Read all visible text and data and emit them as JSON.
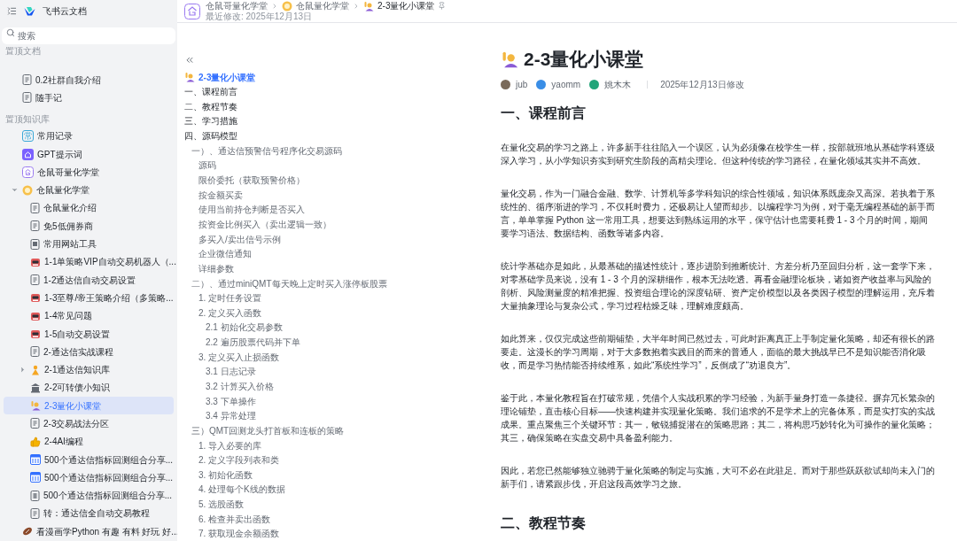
{
  "sidebar": {
    "app_title": "飞书云文档",
    "search": {
      "placeholder": "搜索"
    },
    "sections": [
      {
        "heading": "置顶文档",
        "items": [
          {
            "label": "0.2社群自我介绍",
            "kind": "doc",
            "selected": false
          },
          {
            "label": "随手记",
            "kind": "doc",
            "selected": false
          }
        ]
      },
      {
        "heading": "置顶知识库",
        "items": [
          {
            "label": "常用记录",
            "kind": "letter",
            "badge": "常",
            "selected": false
          },
          {
            "label": "GPT提示词",
            "kind": "home",
            "selected": false
          },
          {
            "label": "仓鼠哥量化学堂",
            "kind": "logo",
            "selected": false
          },
          {
            "label": "仓鼠量化学堂",
            "kind": "medal",
            "selected": false,
            "expanded": true,
            "children": [
              {
                "label": "仓鼠量化介绍",
                "kind": "doc",
                "selected": false
              },
              {
                "label": "免5低佣券商",
                "kind": "doc",
                "selected": false
              },
              {
                "label": "常用网站工具",
                "kind": "grid",
                "selected": false
              },
              {
                "label": "1-1单策略VIP自动交易机器人（...",
                "kind": "robot",
                "selected": false
              },
              {
                "label": "1-2通达信自动交易设置",
                "kind": "doc",
                "selected": false
              },
              {
                "label": "1-3至尊/帝王策略介绍（多策略...",
                "kind": "robot",
                "selected": false
              },
              {
                "label": "1-4常见问题",
                "kind": "robot",
                "selected": false
              },
              {
                "label": "1-5自动交易设置",
                "kind": "robot",
                "selected": false
              },
              {
                "label": "2-通达信实战课程",
                "kind": "doc",
                "selected": false
              },
              {
                "label": "2-1通达信知识库",
                "kind": "figure",
                "selected": false,
                "expanded": false
              },
              {
                "label": "2-2可转债小知识",
                "kind": "building",
                "selected": false
              },
              {
                "label": "2-3量化小课堂",
                "kind": "hand",
                "selected": true
              },
              {
                "label": "2-3交易战法分区",
                "kind": "doc",
                "selected": false
              },
              {
                "label": "2-4AI编程",
                "kind": "thumb",
                "selected": false
              },
              {
                "label": "500个通达信指标回测组合分享...",
                "kind": "table",
                "selected": false
              },
              {
                "label": "500个通达信指标回测组合分享...",
                "kind": "table",
                "selected": false
              },
              {
                "label": "500个通达信指标回测组合分享...",
                "kind": "sheet",
                "selected": false
              },
              {
                "label": "转：通达信全自动交易教程",
                "kind": "doc",
                "selected": false
              }
            ]
          },
          {
            "label": "看漫画学Python 有趣 有料 好玩 好...",
            "kind": "ball",
            "selected": false
          }
        ]
      }
    ]
  },
  "header": {
    "breadcrumbs": [
      {
        "label": "仓鼠哥量化学堂",
        "kind": "none"
      },
      {
        "label": "仓鼠量化学堂",
        "kind": "medal"
      },
      {
        "label": "2-3量化小课堂",
        "kind": "hand"
      }
    ],
    "modified": "最近修改: 2025年12月13日"
  },
  "outline": [
    {
      "label": "2-3量化小课堂",
      "selected": true,
      "kind": "title"
    },
    {
      "label": "一、课程前言",
      "selected": false
    },
    {
      "label": "二、教程节奏",
      "selected": false
    },
    {
      "label": "三、学习措施",
      "selected": false
    },
    {
      "label": "四、源码模型",
      "selected": false,
      "children": [
        {
          "label": "一）、通达信预警信号程序化交易源码",
          "selected": false,
          "children": [
            {
              "label": "源码",
              "selected": false
            },
            {
              "label": "限价委托（获取预警价格）",
              "selected": false
            },
            {
              "label": "按金额买卖",
              "selected": false
            },
            {
              "label": "使用当前持仓判断是否买入",
              "selected": false
            },
            {
              "label": "按资金比例买入（卖出逻辑一致）",
              "selected": false
            },
            {
              "label": "多买入/卖出信号示例",
              "selected": false
            },
            {
              "label": "企业微信通知",
              "selected": false
            },
            {
              "label": "详细参数",
              "selected": false
            }
          ]
        },
        {
          "label": "二）、通过miniQMT每天晚上定时买入涨停板股票",
          "selected": false,
          "children": [
            {
              "label": "1. 定时任务设置",
              "selected": false
            },
            {
              "label": "2. 定义买入函数",
              "selected": false,
              "children": [
                {
                  "label": "2.1 初始化交易参数",
                  "selected": false
                },
                {
                  "label": "2.2 遍历股票代码并下单",
                  "selected": false
                }
              ]
            },
            {
              "label": "3. 定义买入止损函数",
              "selected": false,
              "children": [
                {
                  "label": "3.1 日志记录",
                  "selected": false
                },
                {
                  "label": "3.2 计算买入价格",
                  "selected": false
                },
                {
                  "label": "3.3 下单操作",
                  "selected": false
                },
                {
                  "label": "3.4 异常处理",
                  "selected": false
                }
              ]
            }
          ]
        },
        {
          "label": "三）QMT回测龙头打首板和连板的策略",
          "selected": false,
          "children": [
            {
              "label": "1. 导入必要的库",
              "selected": false
            },
            {
              "label": "2. 定义字段列表和类",
              "selected": false
            },
            {
              "label": "3. 初始化函数",
              "selected": false
            },
            {
              "label": "4. 处理每个K线的数据",
              "selected": false
            },
            {
              "label": "5. 选股函数",
              "selected": false
            },
            {
              "label": "6. 检查并卖出函数",
              "selected": false
            },
            {
              "label": "7. 获取现金余额函数",
              "selected": false
            }
          ]
        }
      ]
    }
  ],
  "document": {
    "title": "2-3量化小课堂",
    "authors": [
      {
        "name": "jub",
        "color": "#7a6a5a"
      },
      {
        "name": "yaomm",
        "color": "#3a8ee6"
      },
      {
        "name": "姚木木",
        "color": "#23a57a"
      }
    ],
    "date": "2025年12月13日修改",
    "blocks": [
      {
        "kind": "h1",
        "text": "一、课程前言"
      },
      {
        "kind": "p",
        "text": "在量化交易的学习之路上，许多新手往往陷入一个误区，认为必须像在校学生一样，按部就班地从基础学科逐级深入学习，从小学知识夯实到研究生阶段的高精尖理论。但这种传统的学习路径，在量化领域其实并不高效。"
      },
      {
        "kind": "p",
        "text": "量化交易，作为一门融合金融、数学、计算机等多学科知识的综合性领域，知识体系既庞杂又高深。若执着于系统性的、循序渐进的学习，不仅耗时费力，还极易让人望而却步。以编程学习为例，对于毫无编程基础的新手而言，单单掌握 Python 这一常用工具，想要达到熟练运用的水平，保守估计也需要耗费 1 - 3 个月的时间，期间要学习语法、数据结构、函数等诸多内容。"
      },
      {
        "kind": "p",
        "text": "统计学基础亦是如此，从最基础的描述性统计，逐步进阶到推断统计、方差分析乃至回归分析，这一套学下来，对零基础学员来说，没有 1 - 3 个月的深耕细作，根本无法吃透。再看金融理论板块，诸如资产收益率与风险的剖析、风险测量度的精准把握、投资组合理论的深度钻研、资产定价模型以及各类因子模型的理解运用，充斥着大量抽象理论与复杂公式，学习过程枯燥乏味，理解难度颇高。"
      },
      {
        "kind": "p",
        "text": "如此算来，仅仅完成这些前期铺垫，大半年时间已然过去，可此时距离真正上手制定量化策略，却还有很长的路要走。这漫长的学习周期，对于大多数抱着实践目的而来的普通人，面临的最大挑战早已不是知识能否消化吸收，而是学习热情能否持续维系，如此“系统性学习”，反倒成了“劝退良方”。"
      },
      {
        "kind": "p",
        "text": "鉴于此，本量化教程旨在打破常规，凭借个人实战积累的学习经验，为新手量身打造一条捷径。摒弃冗长繁杂的理论铺垫，直击核心目标——快速构建并实现量化策略。我们追求的不是学术上的完备体系，而是实打实的实战成果。重点聚焦三个关键环节：其一，敏锐捕捉潜在的策略思路；其二，将构思巧妙转化为可操作的量化策略；其三，确保策略在实盘交易中具备盈利能力。"
      },
      {
        "kind": "p",
        "text": "因此，若您已然能够独立驰骋于量化策略的制定与实施，大可不必在此驻足。而对于那些跃跃欲试却尚未入门的新手们，请紧跟步伐，开启这段高效学习之旅。"
      },
      {
        "kind": "h1",
        "text": "二、教程节奏"
      }
    ]
  }
}
